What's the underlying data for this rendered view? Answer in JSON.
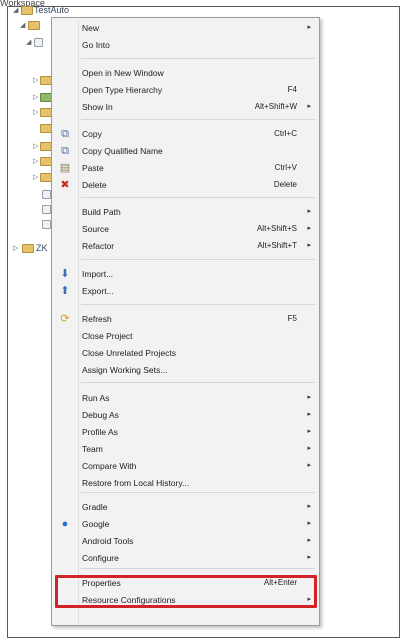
{
  "window": {
    "tab_title": "Workspace"
  },
  "tree": {
    "root_label": "TestAuto",
    "second_root_label": "ZK"
  },
  "context_menu": {
    "items": [
      {
        "label": "New",
        "shortcut": "",
        "submenu": true,
        "icon": ""
      },
      {
        "label": "Go Into",
        "shortcut": "",
        "submenu": false,
        "icon": ""
      },
      {
        "label": "Open in New Window",
        "shortcut": "",
        "submenu": false,
        "icon": ""
      },
      {
        "label": "Open Type Hierarchy",
        "shortcut": "F4",
        "submenu": false,
        "icon": ""
      },
      {
        "label": "Show In",
        "shortcut": "Alt+Shift+W",
        "submenu": true,
        "icon": ""
      },
      {
        "label": "Copy",
        "shortcut": "Ctrl+C",
        "submenu": false,
        "icon": "copy-icon"
      },
      {
        "label": "Copy Qualified Name",
        "shortcut": "",
        "submenu": false,
        "icon": "copy-qualified-name-icon"
      },
      {
        "label": "Paste",
        "shortcut": "Ctrl+V",
        "submenu": false,
        "icon": "paste-icon"
      },
      {
        "label": "Delete",
        "shortcut": "Delete",
        "submenu": false,
        "icon": "delete-icon"
      },
      {
        "label": "Build Path",
        "shortcut": "",
        "submenu": true,
        "icon": ""
      },
      {
        "label": "Source",
        "shortcut": "Alt+Shift+S",
        "submenu": true,
        "icon": ""
      },
      {
        "label": "Refactor",
        "shortcut": "Alt+Shift+T",
        "submenu": true,
        "icon": ""
      },
      {
        "label": "Import...",
        "shortcut": "",
        "submenu": false,
        "icon": "import-icon"
      },
      {
        "label": "Export...",
        "shortcut": "",
        "submenu": false,
        "icon": "export-icon"
      },
      {
        "label": "Refresh",
        "shortcut": "F5",
        "submenu": false,
        "icon": "refresh-icon"
      },
      {
        "label": "Close Project",
        "shortcut": "",
        "submenu": false,
        "icon": ""
      },
      {
        "label": "Close Unrelated Projects",
        "shortcut": "",
        "submenu": false,
        "icon": ""
      },
      {
        "label": "Assign Working Sets...",
        "shortcut": "",
        "submenu": false,
        "icon": ""
      },
      {
        "label": "Run As",
        "shortcut": "",
        "submenu": true,
        "icon": ""
      },
      {
        "label": "Debug As",
        "shortcut": "",
        "submenu": true,
        "icon": ""
      },
      {
        "label": "Profile As",
        "shortcut": "",
        "submenu": true,
        "icon": ""
      },
      {
        "label": "Team",
        "shortcut": "",
        "submenu": true,
        "icon": ""
      },
      {
        "label": "Compare With",
        "shortcut": "",
        "submenu": true,
        "icon": ""
      },
      {
        "label": "Restore from Local History...",
        "shortcut": "",
        "submenu": false,
        "icon": ""
      },
      {
        "label": "Gradle",
        "shortcut": "",
        "submenu": true,
        "icon": ""
      },
      {
        "label": "Google",
        "shortcut": "",
        "submenu": true,
        "icon": "google-icon"
      },
      {
        "label": "Android Tools",
        "shortcut": "",
        "submenu": true,
        "icon": ""
      },
      {
        "label": "Configure",
        "shortcut": "",
        "submenu": true,
        "icon": ""
      },
      {
        "label": "Properties",
        "shortcut": "Alt+Enter",
        "submenu": false,
        "icon": ""
      },
      {
        "label": "Resource Configurations",
        "shortcut": "",
        "submenu": true,
        "icon": ""
      }
    ]
  },
  "colors": {
    "highlight_border": "#d2232a",
    "menu_background": "#f2f2f2"
  }
}
